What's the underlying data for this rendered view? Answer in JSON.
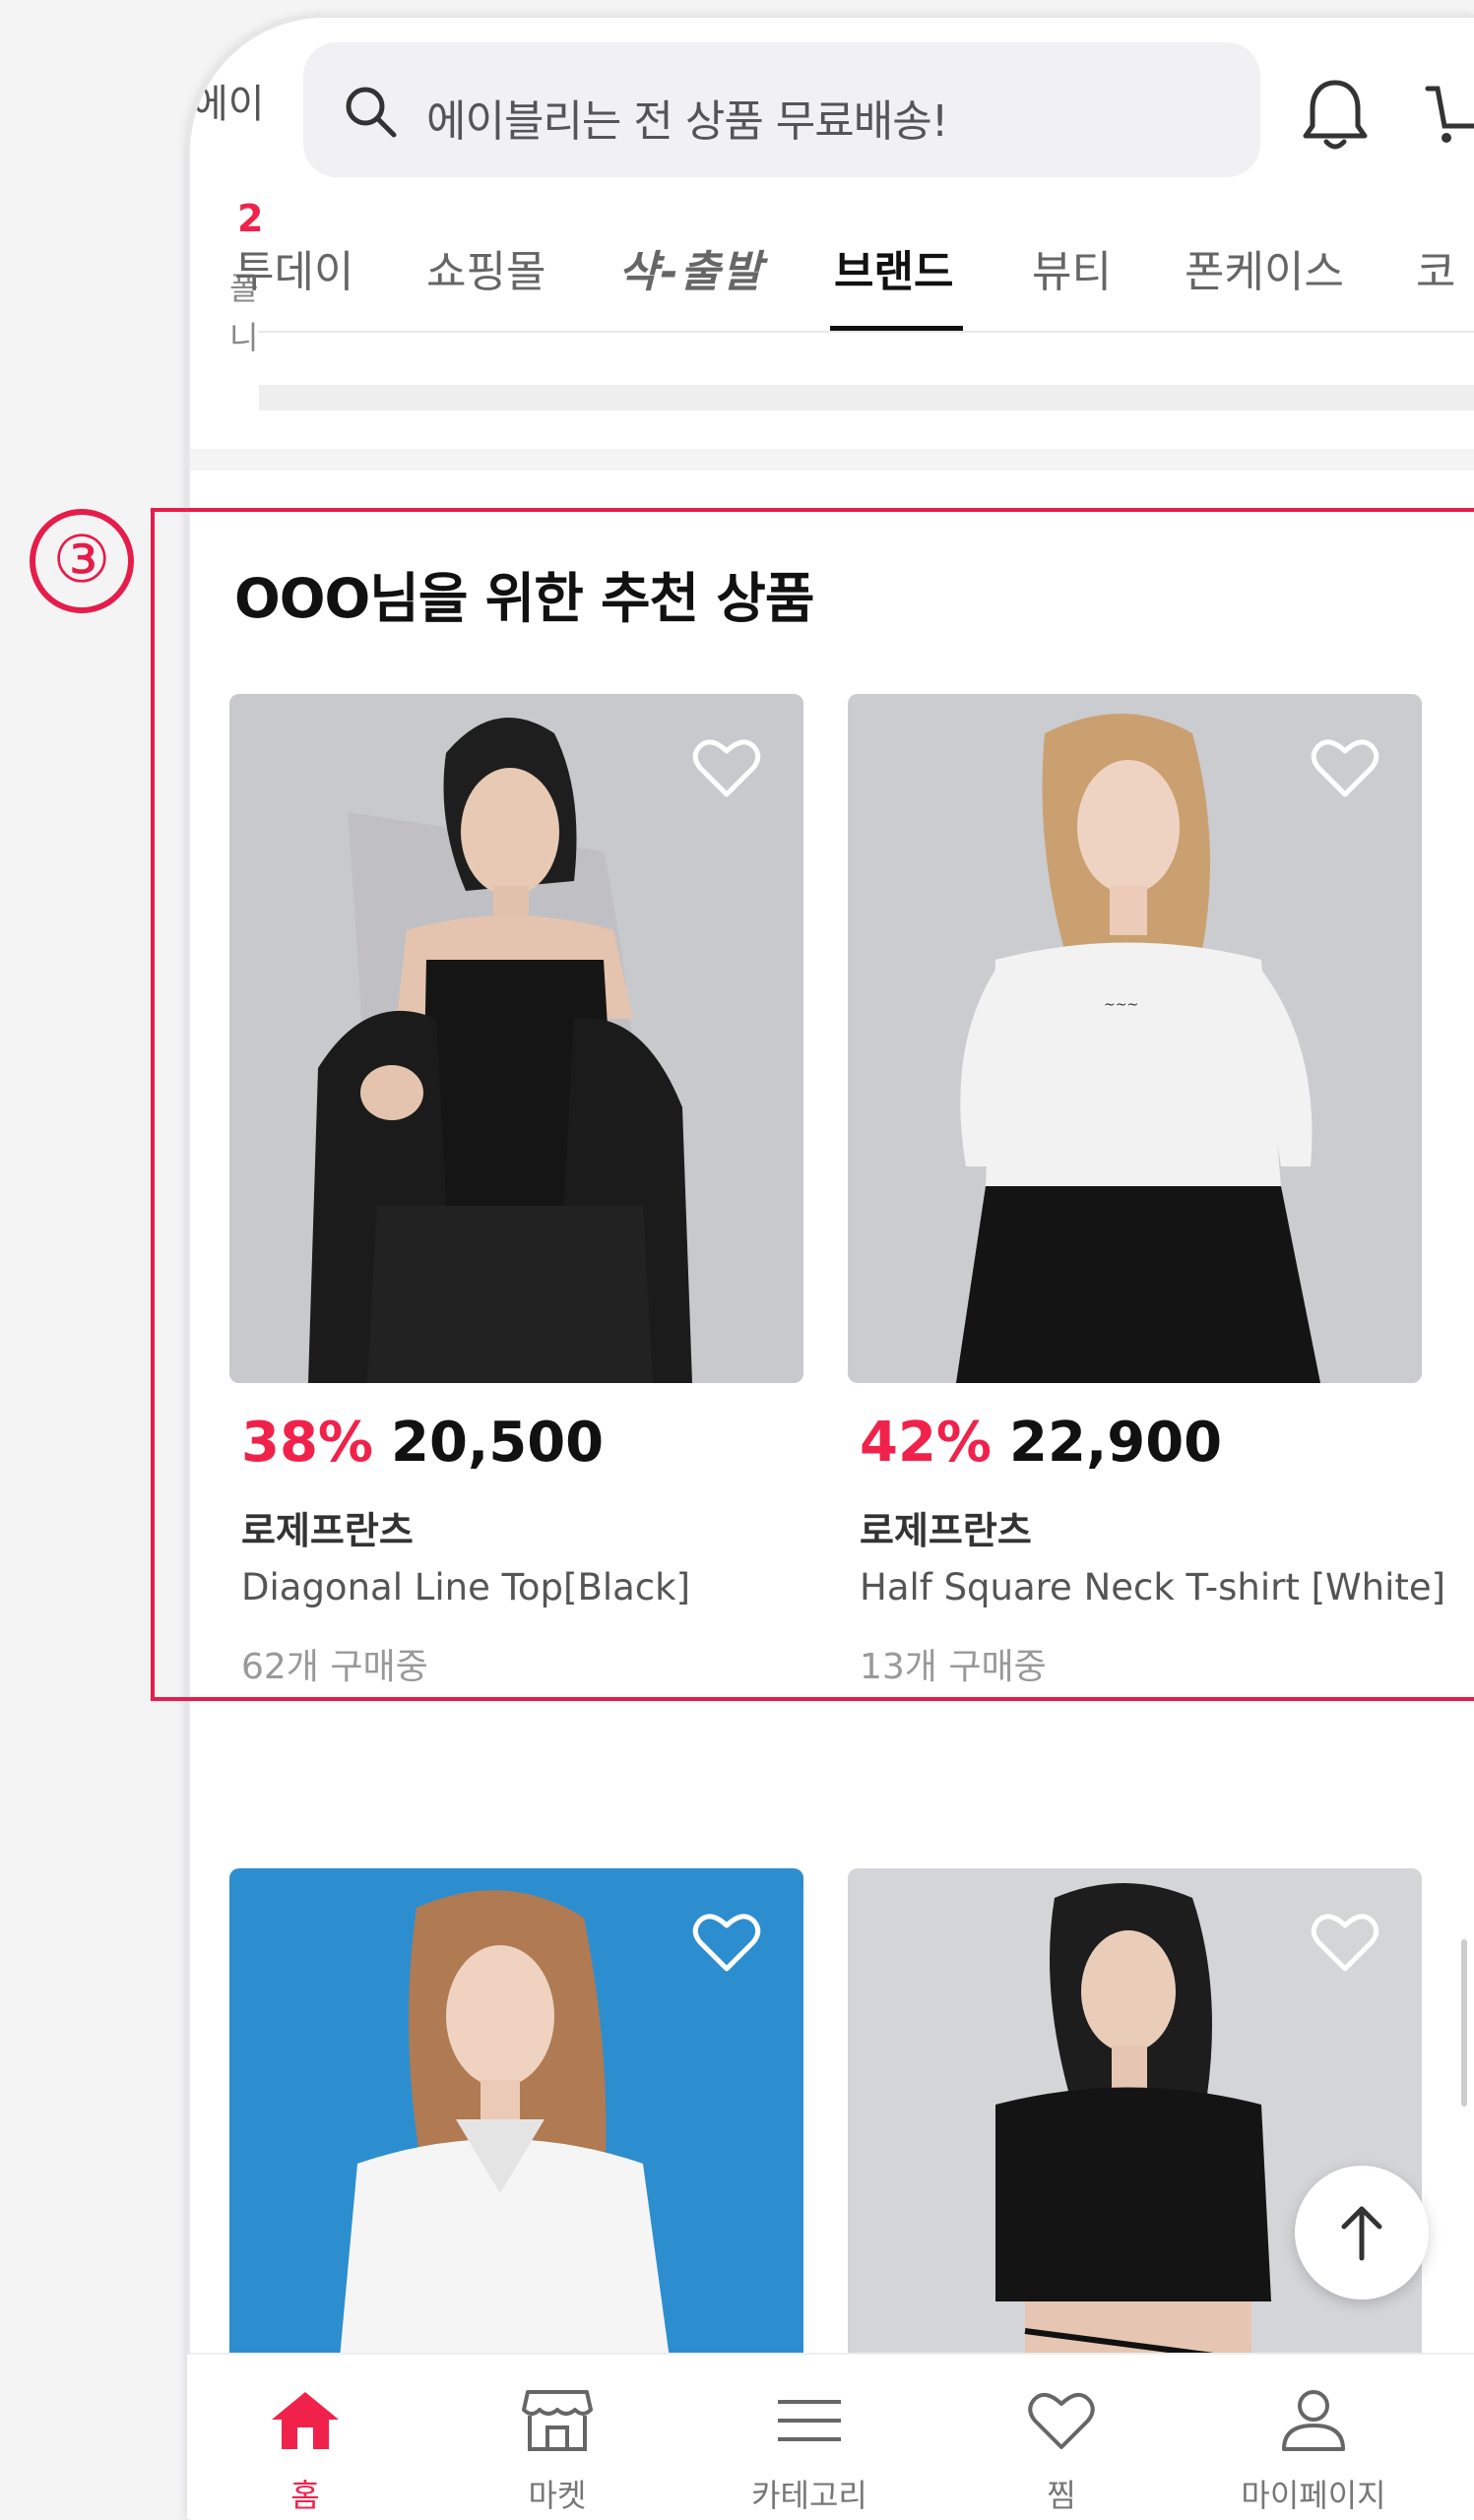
{
  "header": {
    "left_peek_text": "에이",
    "search_placeholder": "에이블리는 전 상품 무료배송!",
    "notification_icon": "bell-icon",
    "cart_icon": "cart-icon"
  },
  "left_peek": {
    "red_badge": "2",
    "line1": "폴",
    "line2": "니"
  },
  "tabs": [
    {
      "label": "투데이",
      "active": false
    },
    {
      "label": "쇼핑몰",
      "active": false
    },
    {
      "label": "샥-출발",
      "active": false
    },
    {
      "label": "브랜드",
      "active": true
    },
    {
      "label": "뷰티",
      "active": false
    },
    {
      "label": "폰케이스",
      "active": false
    },
    {
      "label": "코",
      "active": false
    }
  ],
  "annotation": {
    "marker": "③",
    "color": "#e51d4a"
  },
  "section": {
    "title": "OOO님을 위한 추천 상품"
  },
  "products": [
    {
      "discount": "38%",
      "price": "20,500",
      "brand": "로제프란츠",
      "name": "Diagonal Line Top[Black]",
      "sold": "62개 구매중",
      "bg": "#c6c7cb"
    },
    {
      "discount": "42%",
      "price": "22,900",
      "brand": "로제프란츠",
      "name": "Half Square Neck T-shirt [White]",
      "sold": "13개 구매중",
      "bg": "#c9cacd"
    },
    {
      "bg": "#2b8fcf"
    },
    {
      "bg": "#d5d6d8"
    }
  ],
  "bottom_nav": [
    {
      "label": "홈",
      "icon": "home-icon",
      "active": true
    },
    {
      "label": "마켓",
      "icon": "store-icon",
      "active": false
    },
    {
      "label": "카테고리",
      "icon": "menu-icon",
      "active": false
    },
    {
      "label": "찜",
      "icon": "heart-icon",
      "active": false
    },
    {
      "label": "마이페이지",
      "icon": "user-icon",
      "active": false
    }
  ],
  "colors": {
    "accent": "#f0224b",
    "text": "#111111"
  }
}
